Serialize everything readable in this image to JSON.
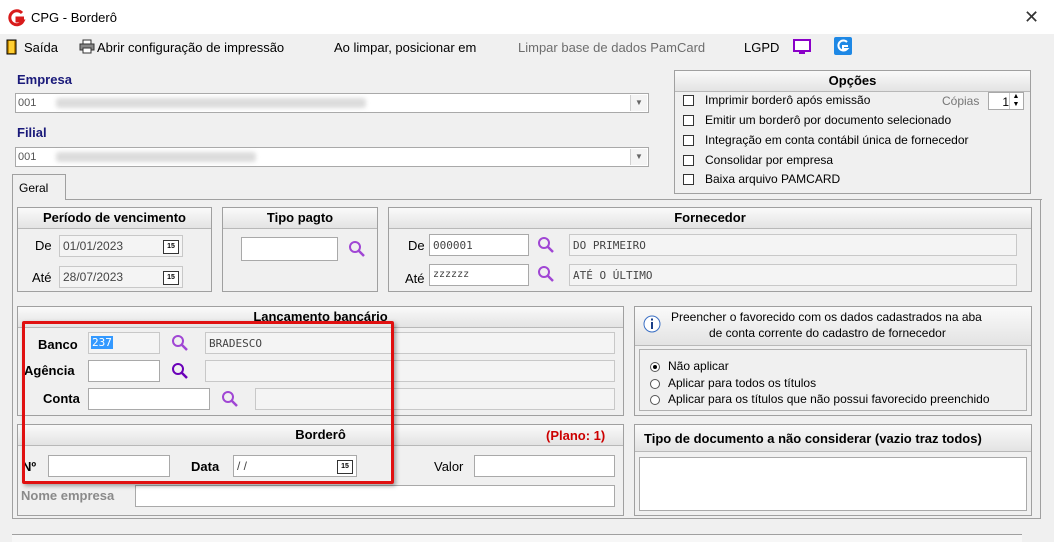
{
  "window": {
    "title": "CPG - Borderô"
  },
  "menu": {
    "exit": "Saída",
    "print_config": "Abrir configuração de impressão",
    "on_clear": "Ao limpar, posicionar em",
    "clear_db": "Limpar base de dados PamCard",
    "lgpd": "LGPD"
  },
  "empresa": {
    "label": "Empresa",
    "code": "001"
  },
  "filial": {
    "label": "Filial",
    "code": "001"
  },
  "tabs": [
    {
      "label": "Geral"
    }
  ],
  "opcoes": {
    "title": "Opções",
    "items": [
      "Imprimir borderô após emissão",
      "Emitir um borderô por documento selecionado",
      "Integração em conta contábil única de fornecedor",
      "Consolidar por empresa",
      "Baixa arquivo PAMCARD"
    ],
    "copies_label": "Cópias",
    "copies_value": "1"
  },
  "periodo": {
    "title": "Período de vencimento",
    "de_label": "De",
    "de_value": "01/01/2023",
    "ate_label": "Até",
    "ate_value": "28/07/2023",
    "cal_text": "15"
  },
  "tipo_pagto": {
    "title": "Tipo pagto"
  },
  "fornecedor": {
    "title": "Fornecedor",
    "de_label": "De",
    "de_code": "000001",
    "de_name": "DO PRIMEIRO",
    "ate_label": "Até",
    "ate_code": "zzzzzz",
    "ate_name": "ATÉ O ÚLTIMO"
  },
  "lancamento": {
    "title": "Lançamento bancário",
    "banco_label": "Banco",
    "banco_code": "237",
    "banco_name": "BRADESCO",
    "agencia_label": "Agência",
    "conta_label": "Conta"
  },
  "favorecido": {
    "info_line1": "Preencher o favorecido com os dados cadastrados na aba",
    "info_line2": "de conta corrente do cadastro de fornecedor",
    "options": [
      "Não aplicar",
      "Aplicar para todos os títulos",
      "Aplicar para os títulos que não possui favorecido preenchido"
    ],
    "selected_index": 0
  },
  "bordero": {
    "title": "Borderô",
    "plano": "(Plano: 1)",
    "num_label": "Nº",
    "data_label": "Data",
    "data_value": " / /",
    "valor_label": "Valor",
    "nome_empresa_label": "Nome empresa"
  },
  "tipo_doc": {
    "title": "Tipo de documento a não considerar (vazio traz todos)"
  },
  "colors": {
    "highlight_red": "#e01010",
    "label_blue": "#1a1a7a",
    "selection_blue": "#3399ff"
  }
}
